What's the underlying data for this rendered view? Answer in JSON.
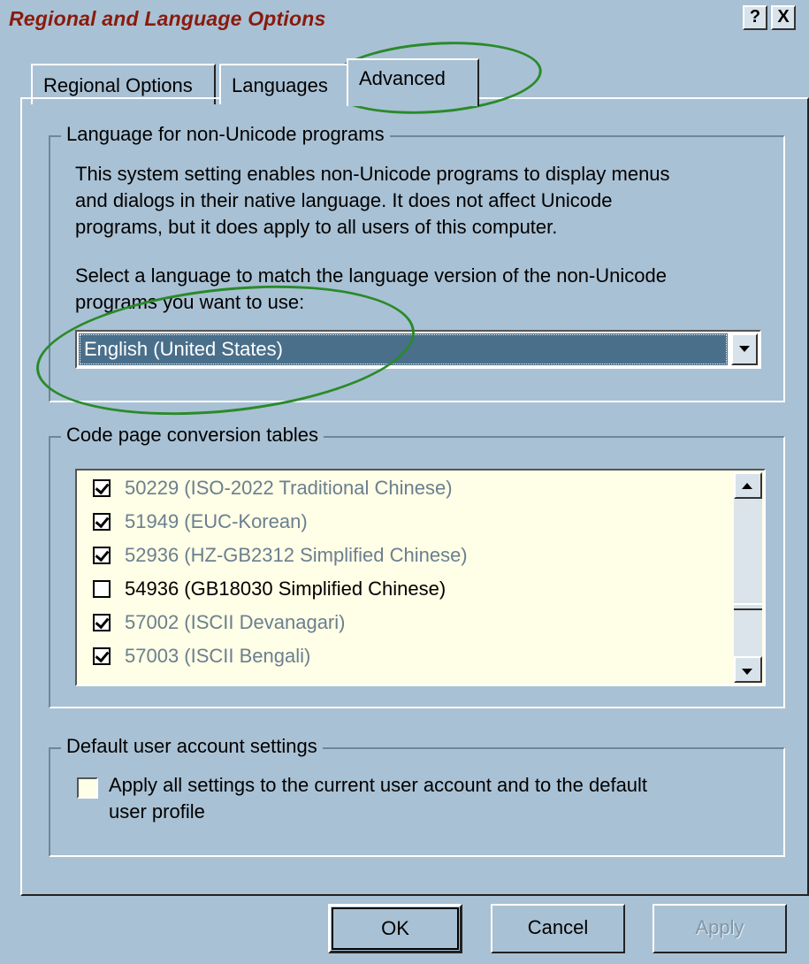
{
  "window": {
    "title": "Regional and Language Options",
    "help_button": "?",
    "close_button": "X"
  },
  "tabs": [
    {
      "label": "Regional Options",
      "active": false
    },
    {
      "label": "Languages",
      "active": false
    },
    {
      "label": "Advanced",
      "active": true
    }
  ],
  "non_unicode": {
    "group_title": "Language for non-Unicode programs",
    "description_lines": [
      "This system setting enables non-Unicode programs to display menus",
      "and dialogs in their native language. It does not affect Unicode",
      "programs, but it does apply to all users of this computer."
    ],
    "select_prompt_lines": [
      "Select a language to match the language version of the non-Unicode",
      "programs you want to use:"
    ],
    "selected_language": "English (United States)"
  },
  "code_pages": {
    "group_title": "Code page conversion tables",
    "items": [
      {
        "label": "50229 (ISO-2022 Traditional Chinese)",
        "checked": true,
        "enabled": false
      },
      {
        "label": "51949 (EUC-Korean)",
        "checked": true,
        "enabled": false
      },
      {
        "label": "52936 (HZ-GB2312 Simplified Chinese)",
        "checked": true,
        "enabled": false
      },
      {
        "label": "54936 (GB18030 Simplified Chinese)",
        "checked": false,
        "enabled": true
      },
      {
        "label": "57002 (ISCII Devanagari)",
        "checked": true,
        "enabled": false
      },
      {
        "label": "57003 (ISCII Bengali)",
        "checked": true,
        "enabled": false
      }
    ]
  },
  "default_user": {
    "group_title": "Default user account settings",
    "checkbox_lines": [
      "Apply all settings to the current user account and to the default",
      "user profile"
    ],
    "checked": false
  },
  "buttons": {
    "ok": "OK",
    "cancel": "Cancel",
    "apply": "Apply"
  },
  "colors": {
    "background": "#a9c1d4",
    "title_text": "#8a1a0c",
    "selection": "#496f8b",
    "annotation": "#2a8a2a",
    "list_background": "#fffee6"
  }
}
